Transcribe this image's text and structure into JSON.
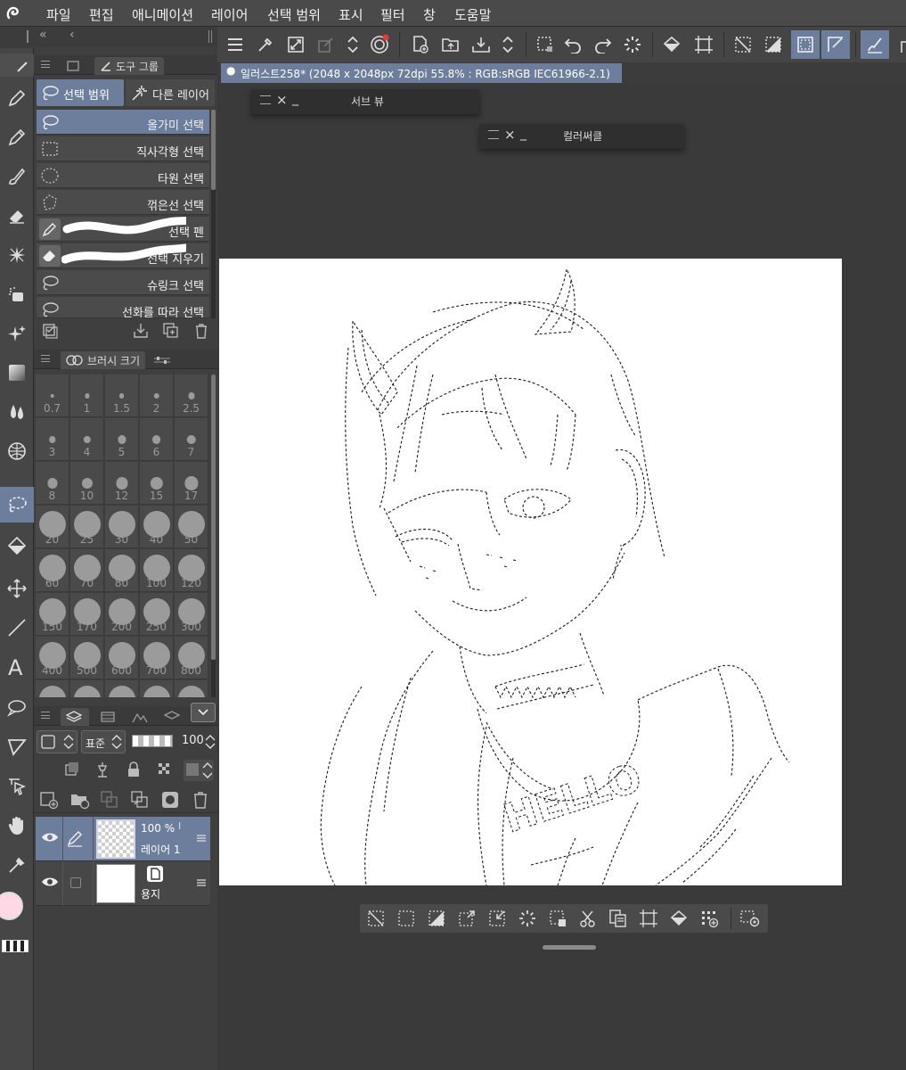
{
  "menu": [
    "파일",
    "편집",
    "애니메이션",
    "레이어",
    "선택 범위",
    "표시",
    "필터",
    "창",
    "도움말"
  ],
  "doc_tab": "일러스트258* (2048 x 2048px 72dpi 55.8% : RGB:sRGB IEC61966-2.1)",
  "sub_view": {
    "title": "서브 뷰"
  },
  "color_circle": {
    "title": "컬러써클"
  },
  "tool_group_tab": "도구 그룹",
  "subtool_tabs": [
    "선택 범위",
    "다른 레이어"
  ],
  "subtools": [
    "올가미 선택",
    "직사각형 선택",
    "타원 선택",
    "꺾은선 선택",
    "선택 펜",
    "선택 지우기",
    "슈링크 선택",
    "선화를 따라 선택"
  ],
  "brush_tab": "브러시 크기",
  "brush_sizes": [
    "0.7",
    "1",
    "1.5",
    "2",
    "2.5",
    "3",
    "4",
    "5",
    "6",
    "7",
    "8",
    "10",
    "12",
    "15",
    "17",
    "20",
    "25",
    "30",
    "40",
    "50",
    "60",
    "70",
    "80",
    "100",
    "120",
    "150",
    "170",
    "200",
    "250",
    "300",
    "400",
    "500",
    "600",
    "700",
    "800"
  ],
  "layer_panel": {
    "blend": "표준",
    "opacity": "100"
  },
  "layers": [
    {
      "opacity": "100 %",
      "name": "레이어 1"
    },
    {
      "name": "용지"
    }
  ],
  "canvas_text": "HELLO",
  "colors": {
    "accent": "#6d7d9c",
    "bg": "#3a3a3a",
    "panel": "#3f3f3f",
    "canvas": "#ffffff",
    "main_color": "#ffd8e6"
  }
}
